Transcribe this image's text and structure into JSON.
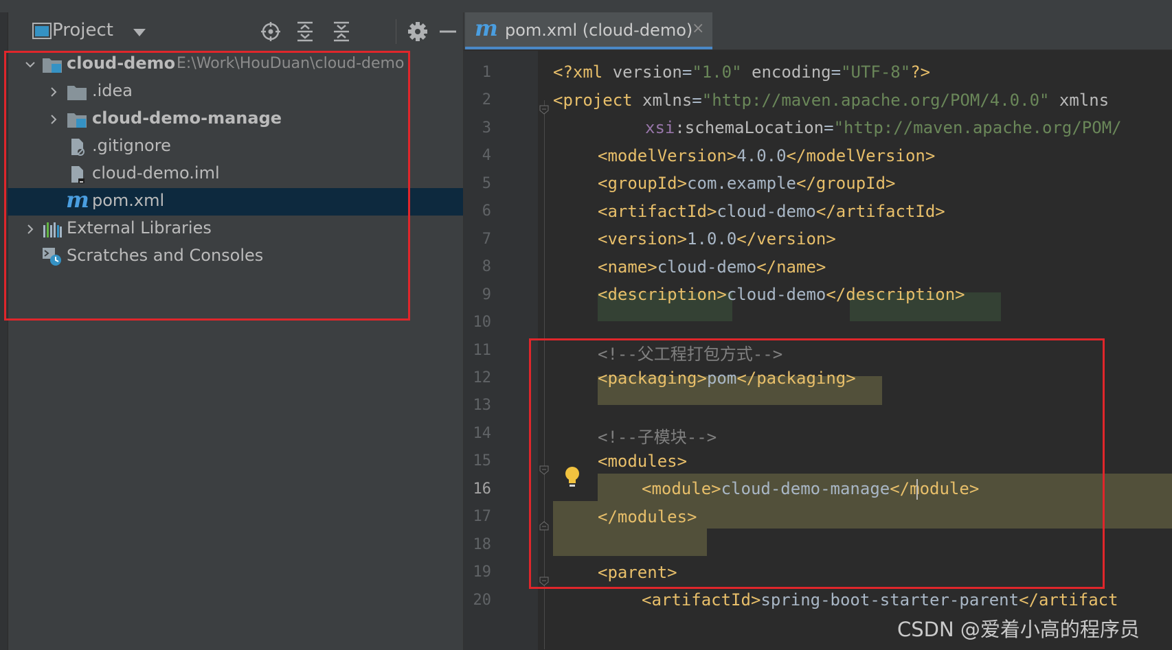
{
  "project_panel": {
    "title": "Project",
    "tree": [
      {
        "label": "cloud-demo",
        "path": "E:\\Work\\HouDuan\\cloud-demo"
      },
      {
        "label": ".idea"
      },
      {
        "label": "cloud-demo-manage"
      },
      {
        "label": ".gitignore"
      },
      {
        "label": "cloud-demo.iml"
      },
      {
        "label": "pom.xml"
      },
      {
        "label": "External Libraries"
      },
      {
        "label": "Scratches and Consoles"
      }
    ]
  },
  "editor": {
    "tab_icon": "m",
    "tab_label": "pom.xml (cloud-demo)",
    "tab_close": "×",
    "line_numbers": [
      "1",
      "2",
      "3",
      "4",
      "5",
      "6",
      "7",
      "8",
      "9",
      "10",
      "11",
      "12",
      "13",
      "14",
      "15",
      "16",
      "17",
      "18",
      "19",
      "20"
    ],
    "current_line": "16",
    "code": {
      "l1": {
        "a": "<?xml ",
        "b": "version",
        "c": "=",
        "d": "\"1.0\"",
        "e": " ",
        "f": "encoding",
        "g": "=",
        "h": "\"UTF-8\"",
        "i": "?>"
      },
      "l2": {
        "a": "<project ",
        "b": "xmlns",
        "c": "=",
        "d": "\"http://maven.apache.org/POM/4.0.0\"",
        "e": " xmlns"
      },
      "l3": {
        "a": "xsi",
        "b": ":schemaLocation",
        "c": "=",
        "d": "\"http://maven.apache.org/POM/"
      },
      "l4": {
        "a": "<modelVersion>",
        "b": "4.0.0",
        "c": "</modelVersion>"
      },
      "l5": {
        "a": "<groupId>",
        "b": "com.example",
        "c": "</groupId>"
      },
      "l6": {
        "a": "<artifactId>",
        "b": "cloud-demo",
        "c": "</artifactId>"
      },
      "l7": {
        "a": "<version>",
        "b": "1.0.0",
        "c": "</version>"
      },
      "l8": {
        "a": "<name>",
        "b": "cloud-demo",
        "c": "</name>"
      },
      "l9": {
        "a": "<description>",
        "b": "cloud-demo",
        "c": "</description>"
      },
      "l11": "<!--父工程打包方式-->",
      "l12": {
        "a": "<packaging>",
        "b": "pom",
        "c": "</packaging>"
      },
      "l14": "<!--子模块-->",
      "l15": "<modules>",
      "l16": {
        "a": "<module>",
        "b": "cloud-demo-manage",
        "c": "</module>"
      },
      "l17": "</modules>",
      "l19": "<parent>",
      "l20": {
        "a": "<artifactId>",
        "b": "spring-boot-starter-parent",
        "c": "</artifact"
      }
    }
  },
  "watermark": "CSDN @爱着小高的程序员",
  "colors": {
    "annotation_box": "#e0262b",
    "selection": "#0d293e",
    "accent": "#4a88c7"
  }
}
